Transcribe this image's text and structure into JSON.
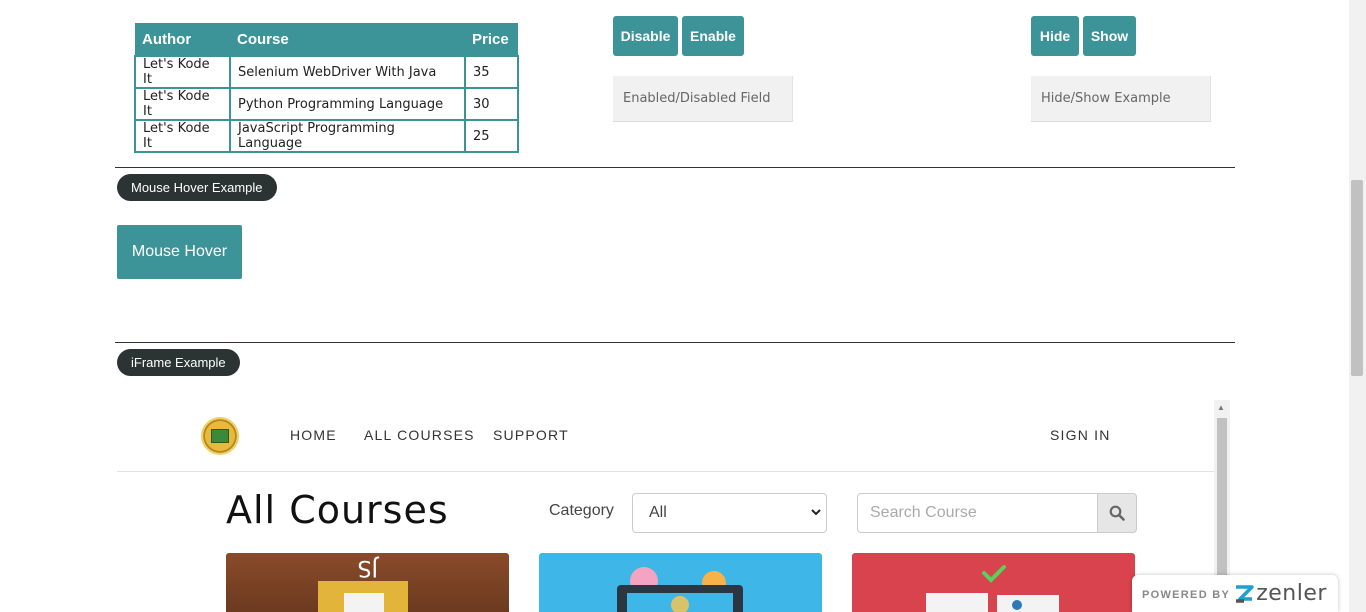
{
  "table": {
    "headers": [
      "Author",
      "Course",
      "Price"
    ],
    "rows": [
      [
        "Let's Kode It",
        "Selenium WebDriver With Java",
        "35"
      ],
      [
        "Let's Kode It",
        "Python Programming Language",
        "30"
      ],
      [
        "Let's Kode It",
        "JavaScript Programming Language",
        "25"
      ]
    ]
  },
  "enable_section": {
    "disable_label": "Disable",
    "enable_label": "Enable",
    "field_placeholder": "Enabled/Disabled Field"
  },
  "hide_section": {
    "hide_label": "Hide",
    "show_label": "Show",
    "field_placeholder": "Hide/Show Example"
  },
  "mouse_hover": {
    "legend": "Mouse Hover Example",
    "button_label": "Mouse Hover"
  },
  "iframe_section": {
    "legend": "iFrame Example"
  },
  "iframe": {
    "nav": {
      "home": "HOME",
      "all_courses": "ALL COURSES",
      "support": "SUPPORT",
      "sign_in": "SIGN IN"
    },
    "heading": "All Courses",
    "category_label": "Category",
    "category_selected": "All",
    "search_placeholder": "Search Course",
    "icons": {
      "logo": "academy-logo-icon",
      "search": "search-icon",
      "select": "chevron-down-icon"
    }
  },
  "badge": {
    "powered_by": "POWERED BY",
    "brand": "zenler"
  },
  "colors": {
    "accent": "#3c9499",
    "pill": "#2b3433"
  }
}
